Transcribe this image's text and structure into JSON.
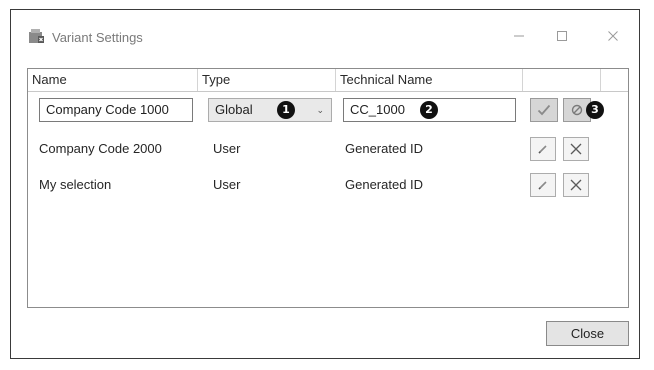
{
  "window": {
    "title": "Variant Settings",
    "app_icon": "variant-app-icon"
  },
  "controls": {
    "minimize": "minimize-icon",
    "maximize": "maximize-icon",
    "close": "close-icon"
  },
  "columns": [
    "Name",
    "Type",
    "Technical Name",
    "",
    ""
  ],
  "rows": [
    {
      "name": "Company Code 1000",
      "type": "Global",
      "technical_name": "CC_1000",
      "editing": true
    },
    {
      "name": "Company Code 2000",
      "type": "User",
      "technical_name": "Generated ID",
      "editing": false
    },
    {
      "name": "My selection",
      "type": "User",
      "technical_name": "Generated ID",
      "editing": false
    }
  ],
  "callouts": [
    "1",
    "2",
    "3"
  ],
  "footer": {
    "close_label": "Close"
  }
}
